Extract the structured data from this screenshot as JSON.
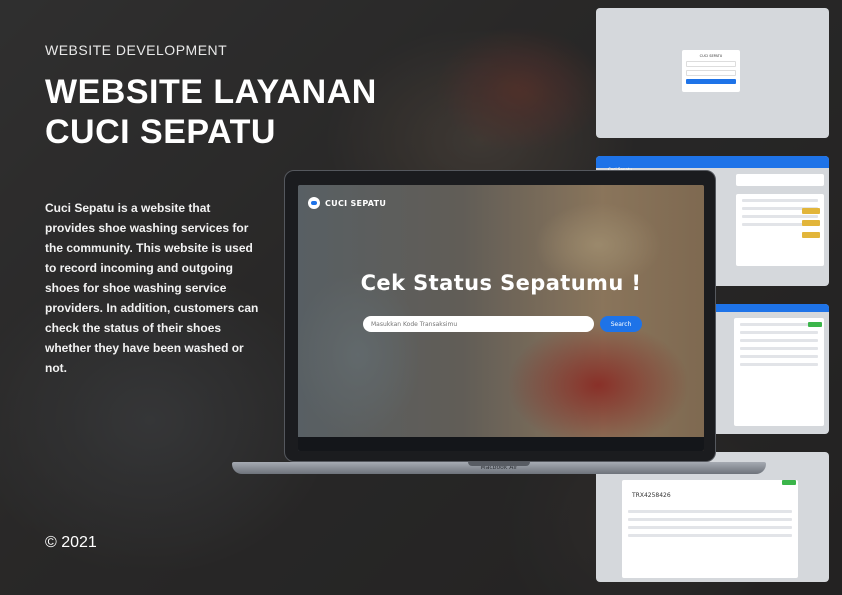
{
  "left": {
    "eyebrow": "WEBSITE DEVELOPMENT",
    "title_line1": "WEBSITE LAYANAN",
    "title_line2": "CUCI SEPATU",
    "description": "Cuci Sepatu is a website that provides shoe washing services for the community. This website is used to record incoming and outgoing shoes for shoe washing service providers. In addition, customers can check the status of their shoes whether they have been washed or not.",
    "copyright": "© 2021"
  },
  "laptop": {
    "brand": "CUCI SEPATU",
    "heading": "Cek Status Sepatumu !",
    "search_placeholder": "Masukkan Kode Transaksimu",
    "search_button": "Search",
    "model_label": "Macbook Air"
  },
  "thumbs": {
    "login_title": "CUCI SEPATU",
    "dashboard_brand": "Cuci Sepatu",
    "detail_code": "TRX4258426"
  },
  "colors": {
    "accent": "#1e73e8",
    "status_yellow": "#e2b53a",
    "status_green": "#3bb54a"
  }
}
